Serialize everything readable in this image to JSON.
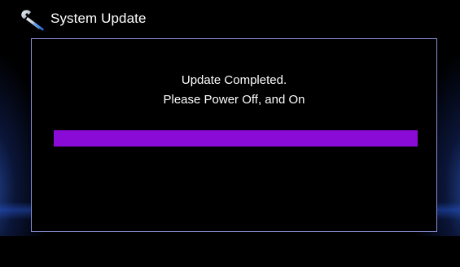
{
  "header": {
    "icon": "wrench-icon",
    "title": "System Update"
  },
  "dialog": {
    "message_line1": "Update Completed.",
    "message_line2": "Please Power Off, and On",
    "progress": 1.0
  },
  "colors": {
    "background": "#000000",
    "progress_fill": "#8a0ad6",
    "dialog_border": "#8a8fd6",
    "edge_glow": "#3c78ff"
  }
}
